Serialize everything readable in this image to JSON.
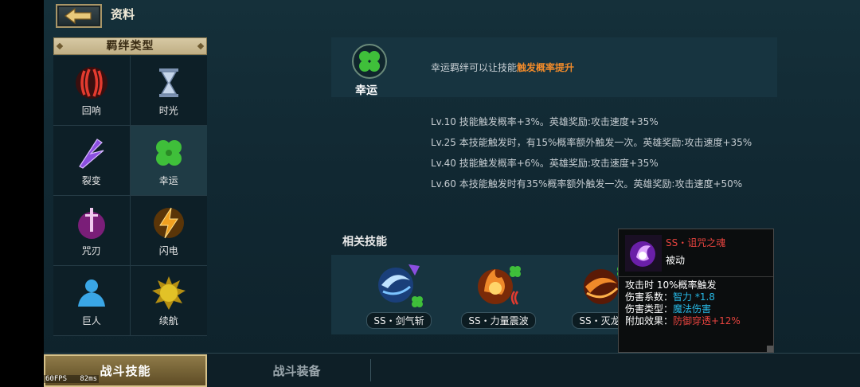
{
  "header": {
    "title": "资料",
    "back_icon": "arrow-left-icon"
  },
  "bond_types": {
    "header": "羁绊类型",
    "items": [
      {
        "label": "回响",
        "icon": "echo-icon",
        "color": "#e43b2f"
      },
      {
        "label": "时光",
        "icon": "hourglass-icon",
        "color": "#8aa7c9"
      },
      {
        "label": "裂变",
        "icon": "fission-icon",
        "color": "#8b4fe0"
      },
      {
        "label": "幸运",
        "icon": "clover-icon",
        "color": "#3fbf3a",
        "selected": true
      },
      {
        "label": "咒刃",
        "icon": "cursed-blade-icon",
        "color": "#c840c8"
      },
      {
        "label": "闪电",
        "icon": "lightning-icon",
        "color": "#f0a020"
      },
      {
        "label": "巨人",
        "icon": "giant-icon",
        "color": "#3aa6e6"
      },
      {
        "label": "续航",
        "icon": "sun-icon",
        "color": "#e2c227"
      }
    ]
  },
  "luck": {
    "name": "幸运",
    "icon": "clover-icon",
    "desc_prefix": "幸运羁绊可以让技能",
    "desc_highlight": "触发概率提升",
    "levels": [
      "Lv.10  技能触发概率+3%。英雄奖励:攻击速度+35%",
      "Lv.25  本技能触发时，有15%概率额外触发一次。英雄奖励:攻击速度+35%",
      "Lv.40  技能触发概率+6%。英雄奖励:攻击速度+35%",
      "Lv.60  本技能触发时有35%概率额外触发一次。英雄奖励:攻击速度+50%"
    ]
  },
  "related": {
    "title": "相关技能",
    "skills": [
      {
        "label": "SS・剑气斩",
        "icon": "sword-wind-icon"
      },
      {
        "label": "SS・力量震波",
        "icon": "fire-wave-icon"
      },
      {
        "label": "SS・灭龙斩",
        "icon": "dragon-slash-icon"
      }
    ]
  },
  "tooltip": {
    "name": "SS・诅咒之魂",
    "type": "被动",
    "trigger": "攻击时 10%概率触发",
    "coef_label": "伤害系数：",
    "coef_value": "智力 *1.8",
    "dmg_type_label": "伤害类型：",
    "dmg_type_value": "魔法伤害",
    "extra_label": "附加效果：",
    "extra_value": "防御穿透+12%"
  },
  "tabs": {
    "active": "战斗技能",
    "inactive": "战斗装备"
  },
  "fps": {
    "fps": "60FPS",
    "ms": "82ms"
  }
}
